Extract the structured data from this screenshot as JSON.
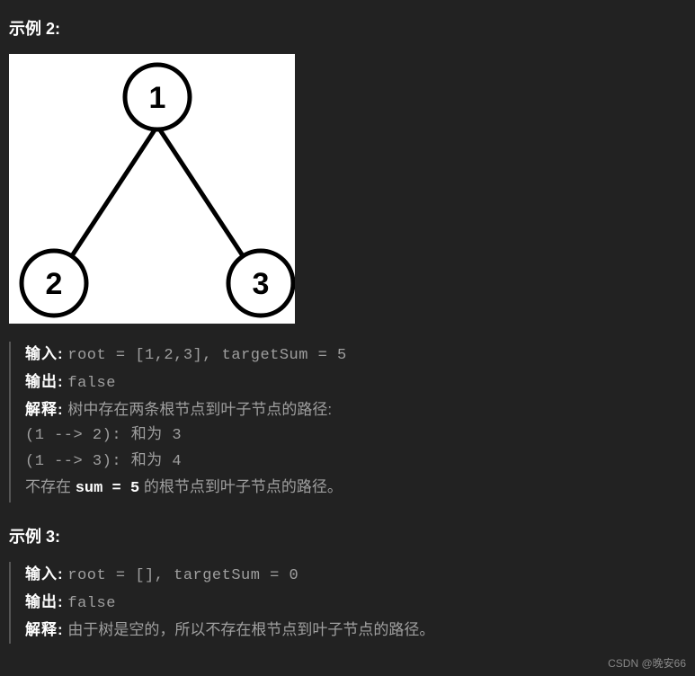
{
  "example2": {
    "heading": "示例 2:",
    "input_label": "输入:",
    "input_value": "root = [1,2,3], targetSum = 5",
    "output_label": "输出:",
    "output_value": "false",
    "explain_label": "解释:",
    "explain_intro": "树中存在两条根节点到叶子节点的路径:",
    "path1": "(1 --> 2): 和为 3",
    "path2": "(1 --> 3): 和为 4",
    "no_exist_prefix": "不存在 ",
    "sum_expr": "sum = 5",
    "no_exist_suffix": " 的根节点到叶子节点的路径。",
    "tree": {
      "root": "1",
      "left": "2",
      "right": "3"
    }
  },
  "example3": {
    "heading": "示例 3:",
    "input_label": "输入:",
    "input_value": "root = [], targetSum = 0",
    "output_label": "输出:",
    "output_value": "false",
    "explain_label": "解释:",
    "explain_text": "由于树是空的，所以不存在根节点到叶子节点的路径。"
  },
  "watermark": "CSDN @晚安66"
}
